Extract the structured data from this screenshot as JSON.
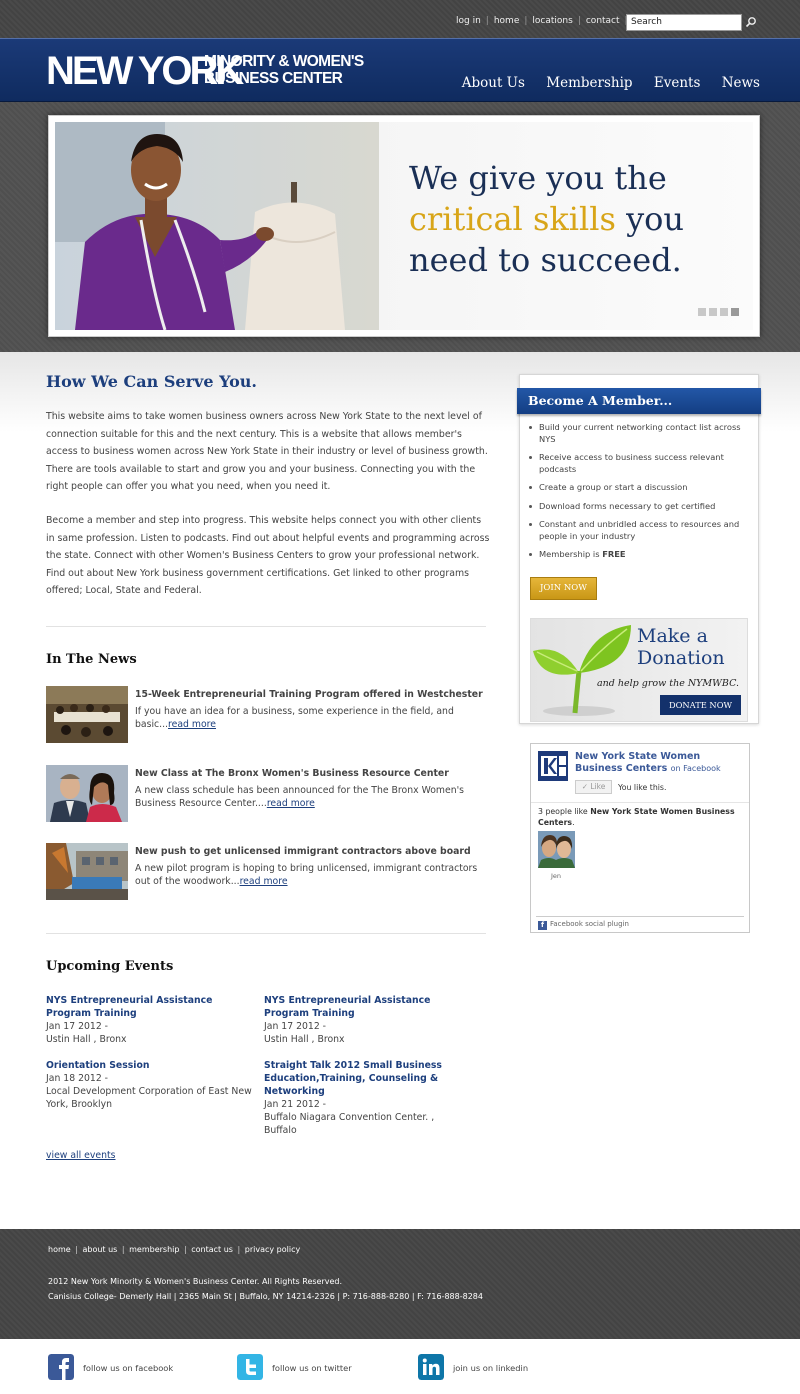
{
  "topbar": {
    "links": [
      "log in",
      "home",
      "locations",
      "contact"
    ],
    "search_value": "Search"
  },
  "header": {
    "logo_line1": "NEW YORK",
    "logo_line2": "MINORITY & WOMEN'S",
    "logo_line3": "BUSINESS CENTER",
    "nav": [
      "About Us",
      "Membership",
      "Events",
      "News"
    ]
  },
  "hero": {
    "line1": "We give you the",
    "highlight": "critical skills",
    "line2_rest": " you",
    "line3": "need to succeed.",
    "slide_count": 4,
    "active_slide": 4
  },
  "serve": {
    "heading": "How We Can Serve You.",
    "p1": "This website aims to take women business owners across New York State to the next level of connection suitable for this and the next century. This is a website that allows member's access to business women across New York State in their industry or level of business growth. There are tools available to start and grow you and your business. Connecting you with the right people can offer you what you need, when you need it.",
    "p2": "Become a member and step into progress. This website helps connect you with other clients in same profession. Listen to podcasts. Find out about helpful events and programming across the state. Connect with other Women's Business Centers to grow your professional network. Find out about New York business government certifications. Get linked to other programs offered; Local, State and Federal."
  },
  "news": {
    "heading": "In The News",
    "read_more": "read more",
    "items": [
      {
        "title": "15-Week Entrepreneurial Training Program offered in Westchester",
        "desc": "If you have an idea for a business, some experience in the field, and basic..."
      },
      {
        "title": "New Class at The Bronx Women's Business Resource Center",
        "desc": "A new class schedule has been announced for the The Bronx Women's Business Resource Center...."
      },
      {
        "title": "New push to get unlicensed immigrant contractors above board",
        "desc": "A new pilot program is hoping to bring unlicensed, immigrant contractors out of the woodwork..."
      }
    ]
  },
  "events": {
    "heading": "Upcoming Events",
    "items": [
      {
        "title": "NYS Entrepreneurial Assistance Program Training",
        "date": "Jan 17 2012 -",
        "place": "Ustin Hall , Bronx"
      },
      {
        "title": "NYS Entrepreneurial Assistance Program Training",
        "date": "Jan 17 2012 -",
        "place": "Ustin Hall , Bronx"
      },
      {
        "title": "Orientation Session",
        "date": "Jan 18 2012 -",
        "place": "Local Development Corporation of East New York, Brooklyn"
      },
      {
        "title": "Straight Talk 2012 Small Business Education,Training, Counseling & Networking",
        "date": "Jan 21 2012 -",
        "place": "Buffalo Niagara Convention Center. , Buffalo"
      }
    ],
    "view_all": "view all events"
  },
  "member": {
    "heading": "Become A Member...",
    "benefits": [
      "Build your current networking contact list across NYS",
      "Receive access to business success relevant podcasts",
      "Create a group or start a discussion",
      "Download forms necessary to get certified",
      "Constant and unbridled access to resources and people in your industry"
    ],
    "last_prefix": "Membership is ",
    "last_bold": "FREE",
    "join_label": "JOIN NOW"
  },
  "donate": {
    "title1": "Make a",
    "title2": "Donation",
    "subtitle": "and help grow the NYMWBC.",
    "button": "DONATE NOW"
  },
  "facebook": {
    "page_name": "New York State Women Business Centers",
    "on_fb": "on Facebook",
    "like": "Like",
    "you_like": "You like this.",
    "count_prefix": "3 people like ",
    "count_bold": "New York State Women Business Centers",
    "count_suffix": ".",
    "face_name": "Jen",
    "plugin": "Facebook social plugin"
  },
  "footer": {
    "links": [
      "home",
      "about us",
      "membership",
      "contact us",
      "privacy policy"
    ],
    "copyright": "2012 New York Minority & Women's Business Center. All Rights Reserved.",
    "address": "Canisius College- Demerly Hall | 2365 Main St | Buffalo, NY 14214-2326 | P: 716-888-8280 | F: 716-888-8284",
    "social": [
      {
        "label": "follow us on facebook",
        "color": "#3b5998"
      },
      {
        "label": "follow us on twitter",
        "color": "#33ccff"
      },
      {
        "label": "join us on linkedin",
        "color": "#0e76a8"
      }
    ]
  },
  "colors": {
    "navy": "#1d3f7d",
    "gold": "#d8a518",
    "header_blue": "#14336d"
  }
}
